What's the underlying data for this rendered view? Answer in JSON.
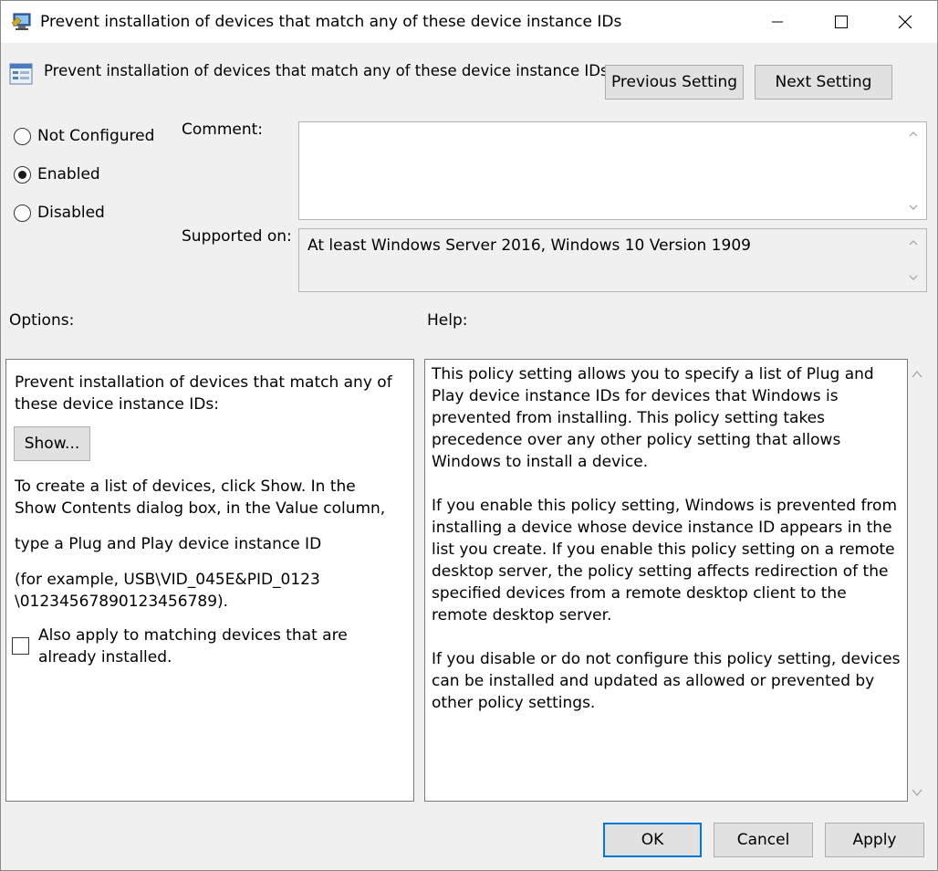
{
  "window": {
    "title": "Prevent installation of devices that match any of these device instance IDs"
  },
  "header": {
    "title": "Prevent installation of devices that match any of these device instance IDs",
    "previous_label": "Previous Setting",
    "next_label": "Next Setting"
  },
  "state": {
    "options": [
      "Not Configured",
      "Enabled",
      "Disabled"
    ],
    "selected": "Enabled"
  },
  "comment": {
    "label": "Comment:",
    "value": ""
  },
  "supported": {
    "label": "Supported on:",
    "value": "At least Windows Server 2016, Windows 10 Version 1909"
  },
  "options_panel": {
    "label": "Options:",
    "description": "Prevent installation of devices that match any of these device instance IDs:",
    "show_button": "Show...",
    "instructions_1": "To create a list of devices, click Show. In the Show Contents dialog box, in the Value column,",
    "instructions_2": "type a Plug and Play device instance ID",
    "instructions_3": "(for example, USB\\VID_045E&PID_0123 \\01234567890123456789).",
    "checkbox_label": "Also apply to matching devices that are already installed.",
    "checkbox_checked": false
  },
  "help_panel": {
    "label": "Help:",
    "paragraphs": [
      "This policy setting allows you to specify a list of Plug and Play device instance IDs for devices that Windows is prevented from installing. This policy setting takes precedence over any other policy setting that allows Windows to install a device.",
      "If you enable this policy setting, Windows is prevented from installing a device whose device instance ID appears in the list you create. If you enable this policy setting on a remote desktop server, the policy setting affects redirection of the specified devices from a remote desktop client to the remote desktop server.",
      "If you disable or do not configure this policy setting, devices can be installed and updated as allowed or prevented by other policy settings."
    ]
  },
  "footer": {
    "ok_label": "OK",
    "cancel_label": "Cancel",
    "apply_label": "Apply"
  },
  "colors": {
    "window_bg": "#f0f0f0",
    "button_bg": "#e1e1e1",
    "default_button_border": "#0078d7"
  }
}
